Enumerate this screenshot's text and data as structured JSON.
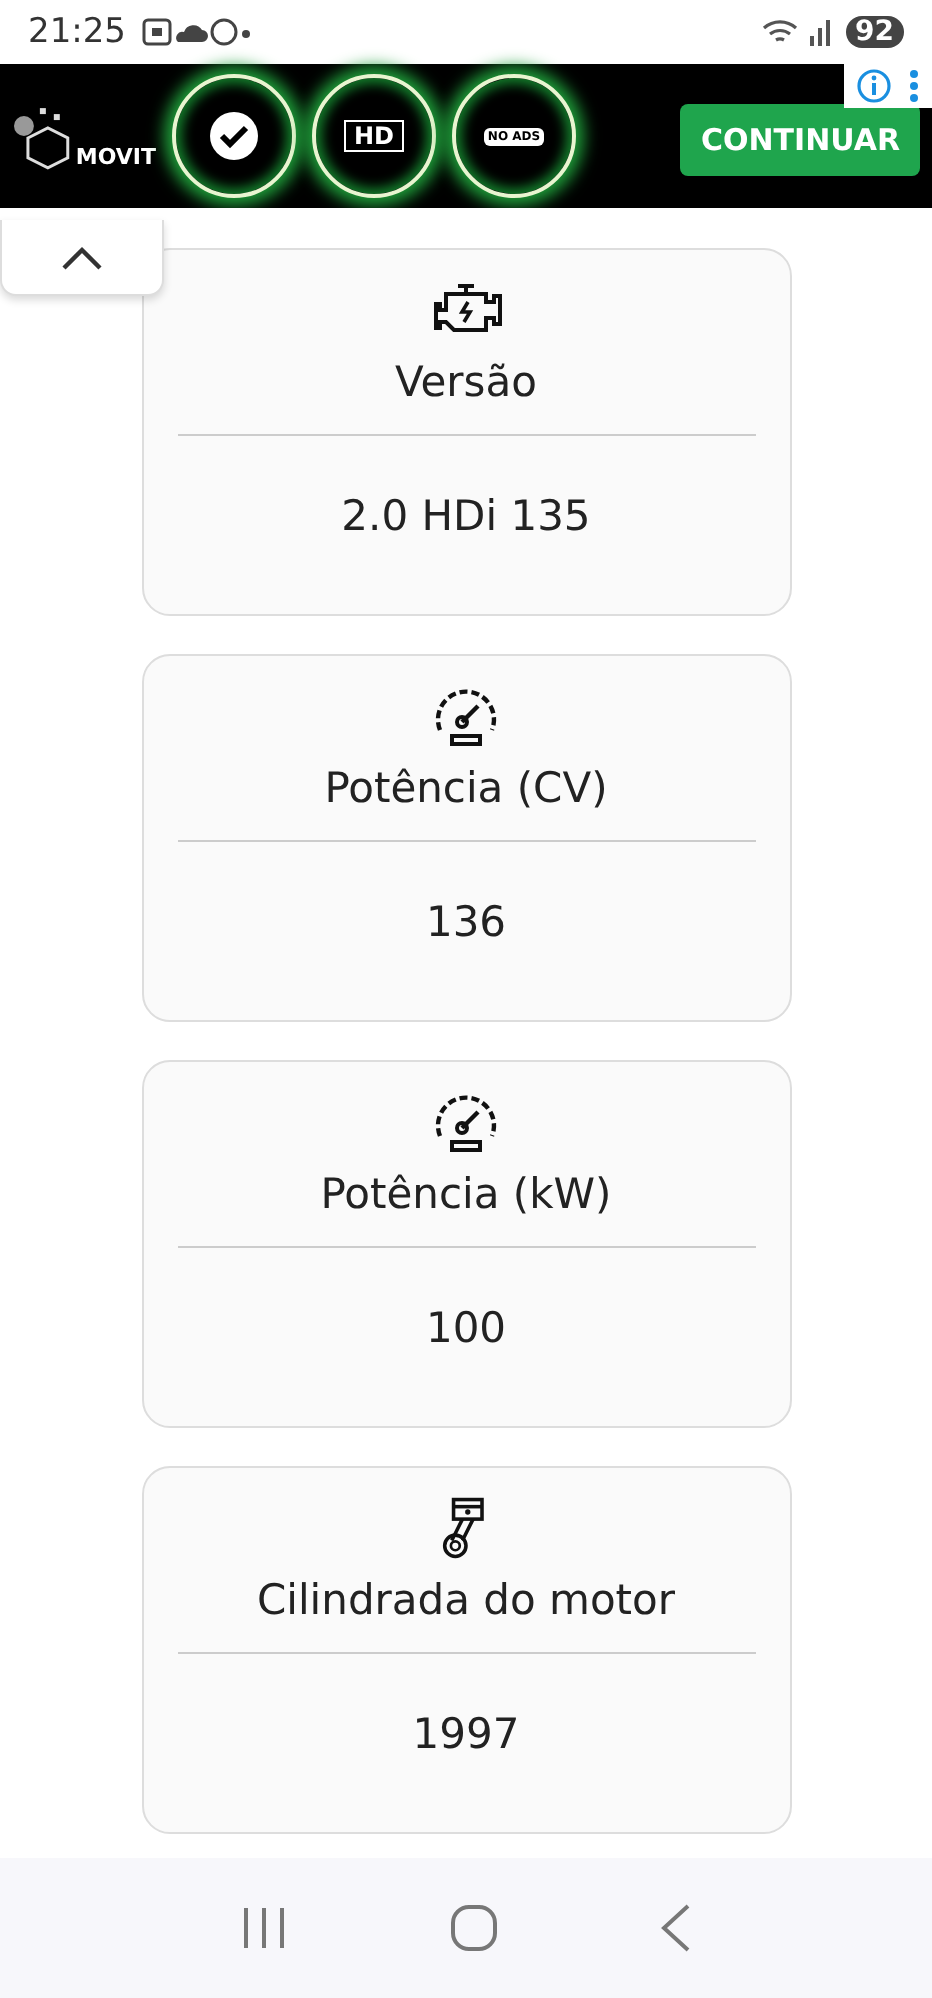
{
  "status_bar": {
    "time": "21:25",
    "battery": "92"
  },
  "ad_banner": {
    "brand": "MOVIT",
    "badges": [
      {
        "kind": "check"
      },
      {
        "kind": "hd",
        "label": "HD"
      },
      {
        "kind": "noads",
        "label": "NO ADS"
      }
    ],
    "button": "CONTINUAR"
  },
  "specs": [
    {
      "kind": "engine",
      "title": "Versão",
      "value": "2.0 HDi 135"
    },
    {
      "kind": "gauge",
      "title": "Potência (CV)",
      "value": "136"
    },
    {
      "kind": "gauge",
      "title": "Potência (kW)",
      "value": "100"
    },
    {
      "kind": "piston",
      "title": "Cilindrada do motor",
      "value": "1997"
    }
  ]
}
